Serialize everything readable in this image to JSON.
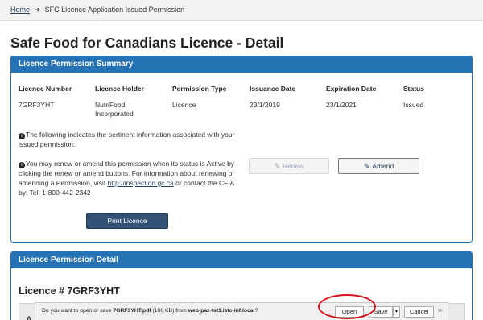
{
  "breadcrumb": {
    "home": "Home",
    "arrow": "➔",
    "current": "SFC Licence Application Issued Permission"
  },
  "page_title": "Safe Food for Canadians Licence - Detail",
  "summary": {
    "heading": "Licence Permission Summary",
    "columns": {
      "licence_number": {
        "label": "Licence Number",
        "value": "7GRF3YHT"
      },
      "licence_holder": {
        "label": "Licence Holder",
        "value": "NutriFood Incorporated"
      },
      "permission_type": {
        "label": "Permission Type",
        "value": "Licence"
      },
      "issuance_date": {
        "label": "Issuance Date",
        "value": "23/1/2019"
      },
      "expiration_date": {
        "label": "Expiration Date",
        "value": "23/1/2021"
      },
      "status": {
        "label": "Status",
        "value": "Issued"
      }
    },
    "info_icon": "i",
    "info_1": "The following indicates the pertinent information associated with your issued permission.",
    "info_2_before": "You may renew or amend this permission when its status is Active by clicking the renew or amend buttons. For information about renewing or amending a Permission, visit ",
    "info_2_link": "http://inspection.gc.ca",
    "info_2_after": " or contact the CFIA by: Tel: 1-800-442-2342",
    "renew_label": "Renew",
    "amend_label": "Amend",
    "print_label": "Print Licence"
  },
  "detail": {
    "heading": "Licence Permission Detail",
    "licence_heading": "Licence # 7GRF3YHT",
    "partial_letter": "A"
  },
  "download_bar": {
    "prompt_before": "Do you want to open or save ",
    "file_name": "7GRF3YHT.pdf",
    "file_size": " (100 KB) from ",
    "host": "web-paz-tst1.istc-inf.local",
    "prompt_after": "?",
    "open_label": "Open",
    "save_label": "Save",
    "dropdown_glyph": "▾",
    "cancel_label": "Cancel",
    "close_glyph": "×"
  },
  "colors": {
    "panel_header": "#2572b4",
    "print_button": "#335075",
    "highlight": "#d6141b"
  },
  "icons": {
    "info": "info-circle-icon",
    "renew": "edit-icon",
    "amend": "edit-icon"
  }
}
